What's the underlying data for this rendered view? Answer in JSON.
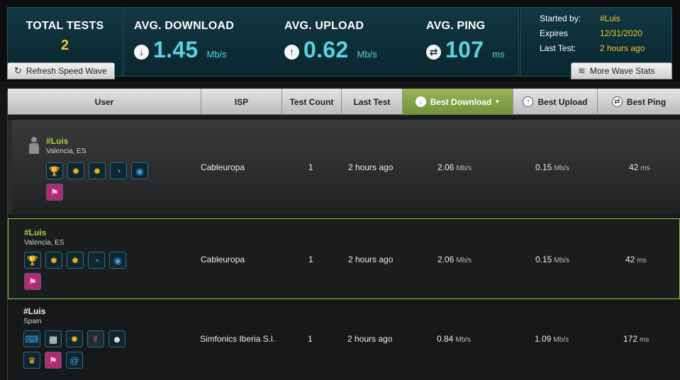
{
  "summary": {
    "total_tests_label": "TOTAL TESTS",
    "total_tests_value": "2",
    "avg_download_label": "AVG. DOWNLOAD",
    "avg_download_value": "1.45",
    "avg_download_unit": "Mb/s",
    "avg_upload_label": "AVG. UPLOAD",
    "avg_upload_value": "0.62",
    "avg_upload_unit": "Mb/s",
    "avg_ping_label": "AVG. PING",
    "avg_ping_value": "107",
    "avg_ping_unit": "ms"
  },
  "info": {
    "started_by_label": "Started by:",
    "started_by_value": "#Luis",
    "expires_label": "Expires",
    "expires_value": "12/31/2020",
    "last_test_label": "Last Test:",
    "last_test_value": "2 hours ago"
  },
  "buttons": {
    "refresh": "Refresh Speed Wave",
    "more_stats": "More Wave Stats"
  },
  "table": {
    "headers": {
      "user": "User",
      "isp": "ISP",
      "test_count": "Test Count",
      "last_test": "Last Test",
      "best_download": "Best Download",
      "best_upload": "Best Upload",
      "best_ping": "Best Ping"
    },
    "sorted_by": "best_download",
    "rows": [
      {
        "user": "#Luis",
        "location": "Valencia, ES",
        "isp": "Cableuropa",
        "test_count": "1",
        "last_test": "2 hours ago",
        "download": "2.06",
        "download_unit": "Mb/s",
        "upload": "0.15",
        "upload_unit": "Mb/s",
        "ping": "42",
        "ping_unit": "ms",
        "badges": [
          "gold-trophy-icon",
          "gold-medal-icon",
          "gold-medal-icon",
          "speedometer-icon",
          "globe-icon",
          "pink-ribbon-icon"
        ]
      },
      {
        "user": "#Luis",
        "location": "Valencia, ES",
        "isp": "Cableuropa",
        "test_count": "1",
        "last_test": "2 hours ago",
        "download": "2.06",
        "download_unit": "Mb/s",
        "upload": "0.15",
        "upload_unit": "Mb/s",
        "ping": "42",
        "ping_unit": "ms",
        "badges": [
          "gold-trophy-icon",
          "gold-medal-icon",
          "gold-medal-icon",
          "speedometer-icon",
          "globe-icon",
          "pink-ribbon-icon"
        ]
      },
      {
        "user": "#Luis",
        "location": "Spain",
        "isp": "Simfonics Iberia S.l.",
        "test_count": "1",
        "last_test": "2 hours ago",
        "download": "0.84",
        "download_unit": "Mb/s",
        "upload": "1.09",
        "upload_unit": "Mb/s",
        "ping": "172",
        "ping_unit": "ms",
        "badges": [
          "computer-user-icon",
          "checkered-flag-icon",
          "gold-medal-icon",
          "rock-hand-icon",
          "panda-icon",
          "podium-icon",
          "pink-ribbon-icon",
          "snail-icon"
        ]
      }
    ]
  }
}
